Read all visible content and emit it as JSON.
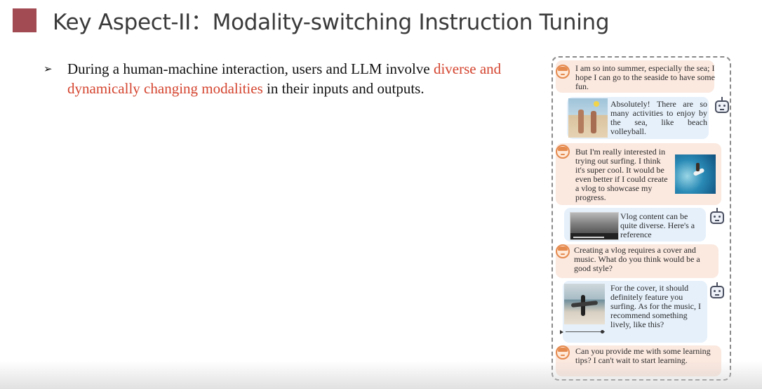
{
  "slide": {
    "title": "Key Aspect-II：Modality-switching Instruction Tuning",
    "bullet": {
      "marker": "➢",
      "text_before": "During a human-machine interaction, users and LLM involve ",
      "highlight": "diverse and dynamically changing modalities",
      "text_after": " in their inputs and outputs."
    },
    "colors": {
      "title_square": "#a24b52",
      "highlight": "#d4442f"
    }
  },
  "chat": {
    "messages": [
      {
        "role": "user",
        "text": "I am so into summer, especially the sea; I hope I can go to the seaside to have some fun."
      },
      {
        "role": "bot",
        "text": "Absolutely! There are so many activities to enjoy by the sea, like beach volleyball."
      },
      {
        "role": "user",
        "text": "But I'm really interested in trying out surfing. I think it's super cool. It would be even better if I could create a vlog to showcase my progress."
      },
      {
        "role": "bot",
        "text": "Vlog content can be quite diverse. Here's a reference"
      },
      {
        "role": "user",
        "text": "Creating a vlog requires a cover and music. What do you think would be a good style?"
      },
      {
        "role": "bot",
        "text": "For the cover, it should definitely feature you surfing. As for the music, I recommend something lively, like this?"
      },
      {
        "role": "user",
        "text": "Can you provide me with some learning tips? I can't wait to start learning."
      }
    ]
  }
}
